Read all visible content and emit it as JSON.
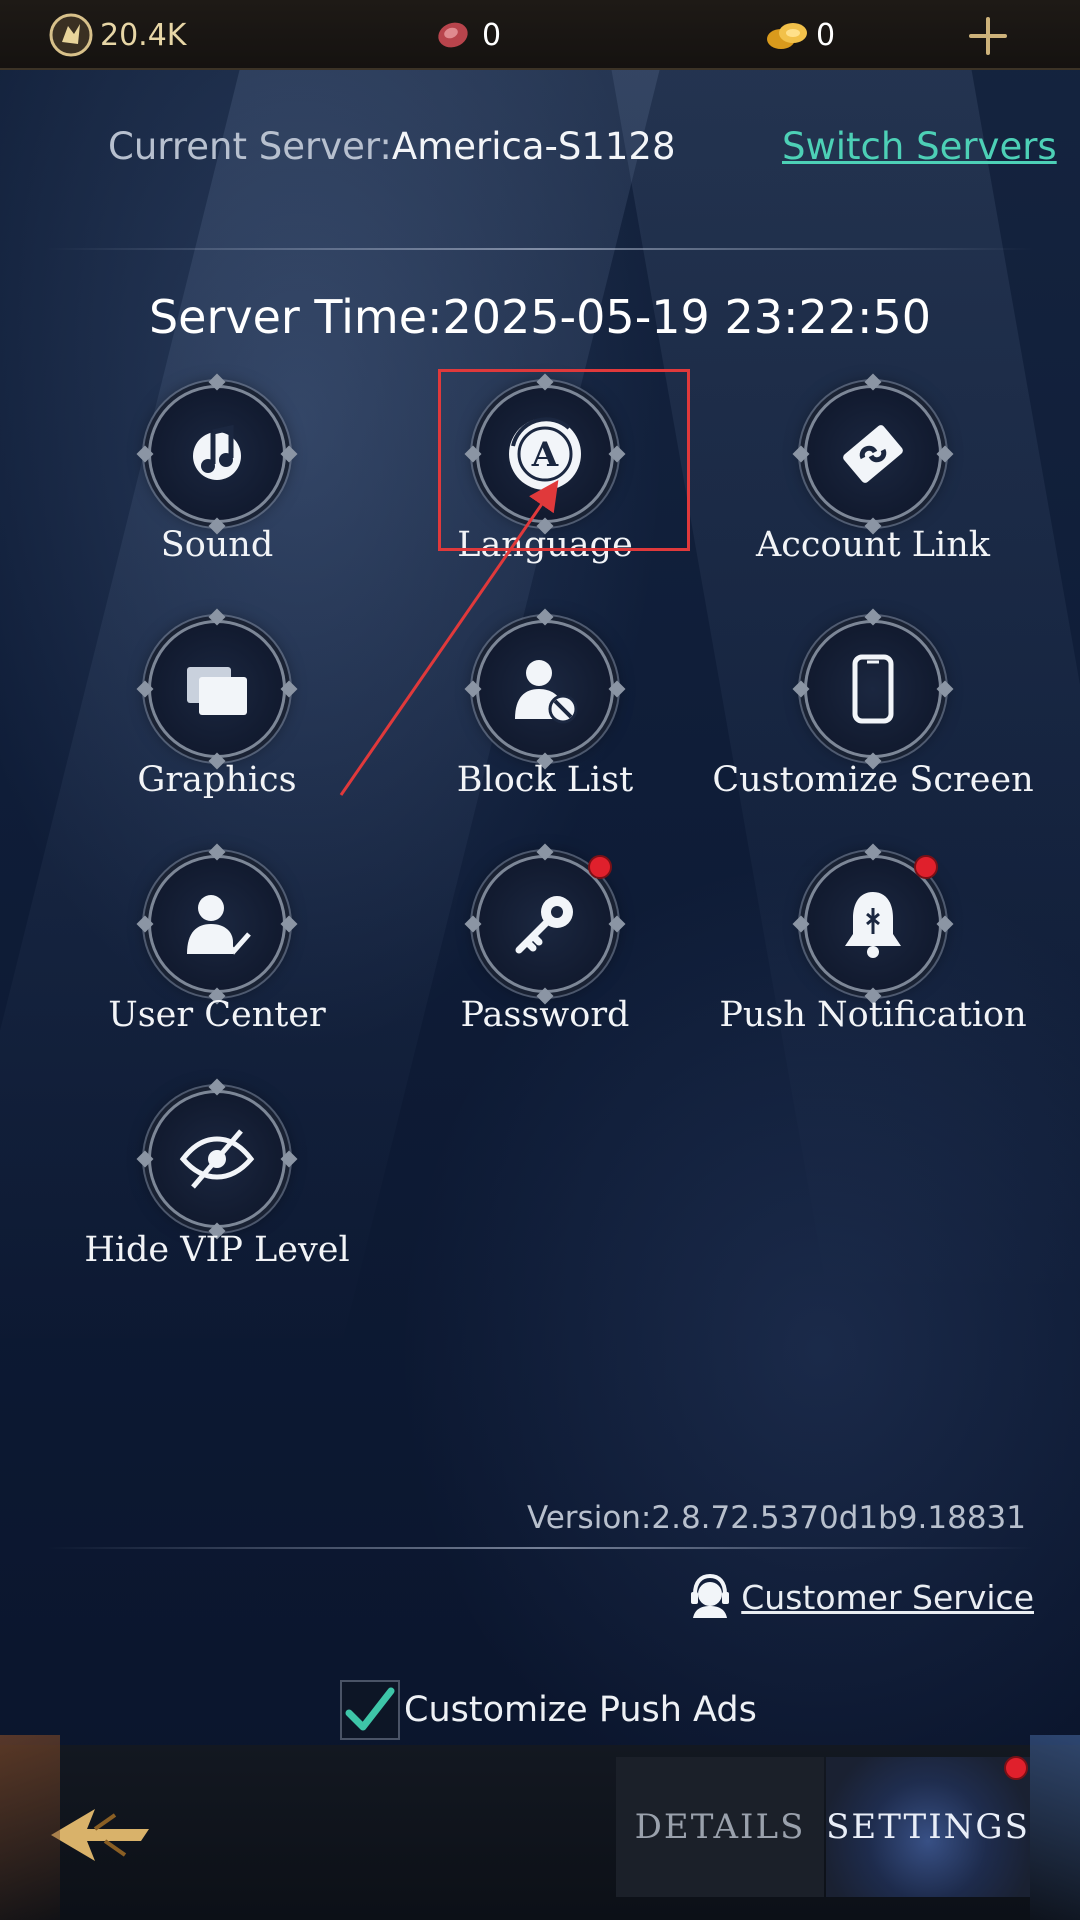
{
  "topbar": {
    "power_value": "20.4K",
    "meat_value": "0",
    "gold_value": "0"
  },
  "server": {
    "label": "Current Server:",
    "name": "America-S1128",
    "switch_link": "Switch Servers",
    "time": "Server Time:2025-05-19 23:22:50"
  },
  "settings_items": [
    {
      "label": "Sound",
      "icon": "music-note-icon",
      "badge": false
    },
    {
      "label": "Language",
      "icon": "language-icon",
      "badge": false
    },
    {
      "label": "Account Link",
      "icon": "account-link-icon",
      "badge": false
    },
    {
      "label": "Graphics",
      "icon": "graphics-icon",
      "badge": false
    },
    {
      "label": "Block List",
      "icon": "block-user-icon",
      "badge": false
    },
    {
      "label": "Customize Screen",
      "icon": "phone-screen-icon",
      "badge": false
    },
    {
      "label": "User Center",
      "icon": "user-check-icon",
      "badge": false
    },
    {
      "label": "Password",
      "icon": "key-icon",
      "badge": true
    },
    {
      "label": "Push Notification",
      "icon": "bell-icon",
      "badge": true
    },
    {
      "label": "Hide VIP Level",
      "icon": "hidden-eye-icon",
      "badge": false
    }
  ],
  "footer": {
    "version": "Version:2.8.72.5370d1b9.18831",
    "customer_service": "Customer Service",
    "push_ads_label": "Customize Push Ads",
    "push_ads_checked": true
  },
  "tabs": {
    "details": "DETAILS",
    "settings": "SETTINGS",
    "active": "settings"
  },
  "colors": {
    "accent_link": "#4dd0b6",
    "badge_red": "#e0202c",
    "highlight_red": "#e0393b"
  }
}
